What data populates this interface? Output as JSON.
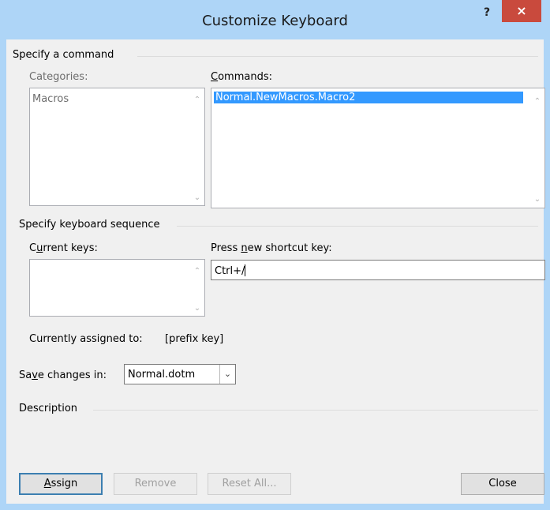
{
  "window": {
    "title": "Customize Keyboard",
    "help_label": "?",
    "close_label": "×"
  },
  "specify_command": {
    "group_label": "Specify a command",
    "categories_label": "Categories:",
    "categories_items": [
      "Macros"
    ],
    "commands_label_prefix": "",
    "commands_label_accel": "C",
    "commands_label_rest": "ommands:",
    "commands_items": [
      "Normal.NewMacros.Macro2"
    ]
  },
  "keyboard_sequence": {
    "group_label": "Specify keyboard sequence",
    "current_keys_label_prefix": "C",
    "current_keys_label_accel": "u",
    "current_keys_label_rest": "rrent keys:",
    "press_new_label_prefix": "Press ",
    "press_new_label_accel": "n",
    "press_new_label_rest": "ew shortcut key:",
    "new_shortcut_value": "Ctrl+/",
    "currently_assigned_label": "Currently assigned to:",
    "currently_assigned_value": "[prefix key]"
  },
  "save_changes": {
    "label_prefix": "Sa",
    "label_accel": "v",
    "label_rest": "e changes in:",
    "value": "Normal.dotm"
  },
  "description": {
    "group_label": "Description"
  },
  "buttons": {
    "assign_accel": "A",
    "assign_rest": "ssign",
    "remove": "Remove",
    "reset_all": "Reset All...",
    "close": "Close"
  },
  "icons": {
    "scroll_up": "chevron-up-icon",
    "scroll_down": "chevron-down-icon",
    "dropdown": "chevron-down-icon"
  },
  "colors": {
    "frame": "#aed5f7",
    "close_button": "#c94a3d",
    "selection": "#3399ff",
    "default_button_border": "#3c7fb1"
  }
}
